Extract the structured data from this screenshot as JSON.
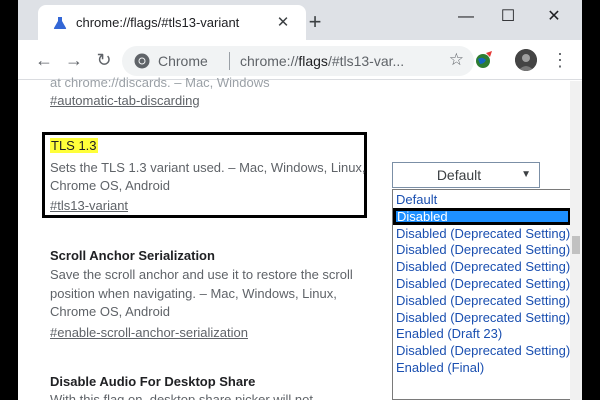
{
  "tab": {
    "title": "chrome://flags/#tls13-variant",
    "close": "✕",
    "new": "+"
  },
  "window_controls": {
    "minimize": "—",
    "maximize": "☐",
    "close": "✕"
  },
  "toolbar": {
    "back": "←",
    "forward": "→",
    "reload": "↻",
    "site_name": "Chrome",
    "url_prefix": "chrome://",
    "url_bold": "flags",
    "url_suffix": "/#tls13-var...",
    "star": "☆",
    "menu": "⋮"
  },
  "content": {
    "prev_flag": {
      "desc_tail": "at chrome://discards. – Mac, Windows",
      "link": "#automatic-tab-discarding"
    },
    "tls_flag": {
      "title": "TLS 1.3",
      "desc_line1": "Sets the TLS 1.3 variant used. – Mac, Windows, Linux,",
      "desc_line2": "Chrome OS, Android",
      "link": "#tls13-variant",
      "select_value": "Default",
      "select_arrow": "▼"
    },
    "scroll_flag": {
      "title": "Scroll Anchor Serialization",
      "desc_line1": "Save the scroll anchor and use it to restore the scroll",
      "desc_line2": "position when navigating. – Mac, Windows, Linux,",
      "desc_line3": "Chrome OS, Android",
      "link": "#enable-scroll-anchor-serialization"
    },
    "audio_flag": {
      "title": "Disable Audio For Desktop Share",
      "desc_partial": "With this flag on, desktop share picker will not"
    }
  },
  "dropdown_options": [
    "Default",
    "Disabled",
    "Disabled (Deprecated Setting)",
    "Disabled (Deprecated Setting)",
    "Disabled (Deprecated Setting)",
    "Disabled (Deprecated Setting)",
    "Disabled (Deprecated Setting)",
    "Disabled (Deprecated Setting)",
    "Enabled (Draft 23)",
    "Disabled (Deprecated Setting)",
    "Enabled (Final)"
  ],
  "dropdown_selected_index": 1,
  "colors": {
    "highlight": "#ffff3a",
    "selected_option": "#1e90ff",
    "option_text": "#1a4fb0"
  }
}
